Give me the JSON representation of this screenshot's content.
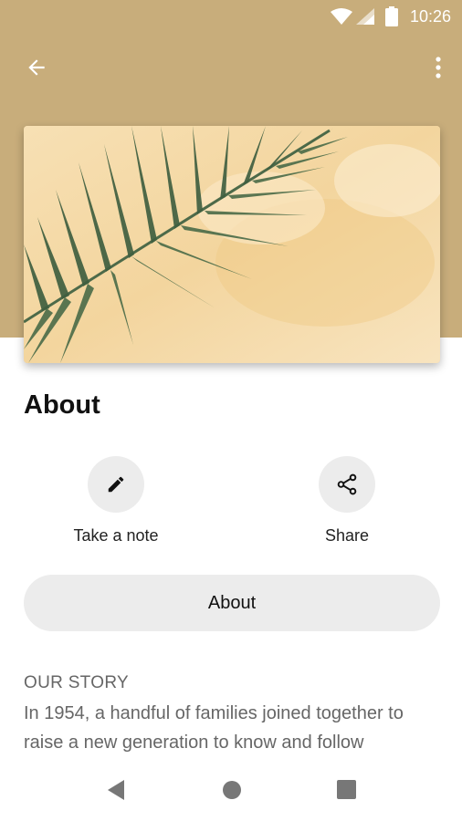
{
  "status_bar": {
    "time": "10:26",
    "icons": [
      "wifi-icon",
      "signal-icon",
      "battery-icon"
    ]
  },
  "toolbar": {
    "back_icon": "arrow-back-icon",
    "menu_icon": "more-vert-icon"
  },
  "hero": {
    "image": "palm-leaf-photo"
  },
  "page": {
    "title": "About"
  },
  "actions": [
    {
      "label": "Take a note",
      "icon": "pencil-icon"
    },
    {
      "label": "Share",
      "icon": "share-icon"
    }
  ],
  "about_button": {
    "label": "About"
  },
  "story": {
    "heading": "OUR STORY",
    "text": "In 1954, a handful of families joined together to raise a new generation to know and follow"
  },
  "nav": {
    "icons": [
      "nav-back-icon",
      "nav-home-icon",
      "nav-recents-icon"
    ]
  },
  "colors": {
    "header": "#c8ad7b",
    "pill": "#ececec",
    "muted_text": "#666666"
  }
}
